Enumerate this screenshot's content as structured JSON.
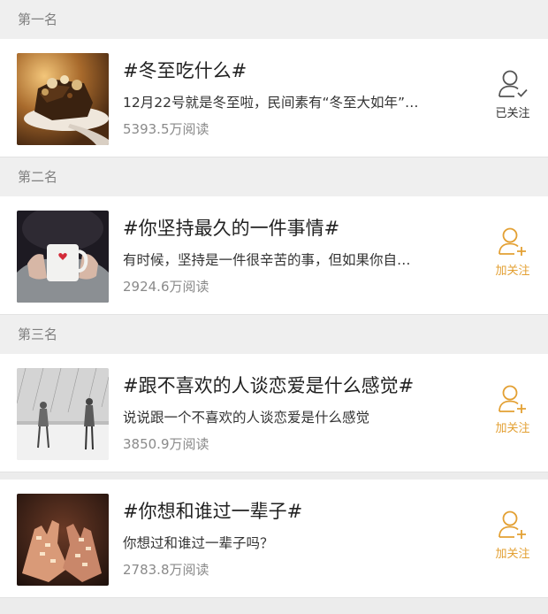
{
  "colors": {
    "accent": "#e3a033",
    "followed_icon": "#555555",
    "muted_text": "#8a8a8a"
  },
  "topics": [
    {
      "rank_label": "第一名",
      "title": "#冬至吃什么#",
      "description": "12月22号就是冬至啦，民间素有“冬至大如年”…",
      "reads": "5393.5万阅读",
      "follow_label": "已关注",
      "followed": true,
      "thumbnail": "dessert-on-spoon-photo"
    },
    {
      "rank_label": "第二名",
      "title": "#你坚持最久的一件事情#",
      "description": "有时候，坚持是一件很辛苦的事，但如果你自…",
      "reads": "2924.6万阅读",
      "follow_label": "加关注",
      "followed": false,
      "thumbnail": "hands-holding-mug-photo"
    },
    {
      "rank_label": "第三名",
      "title": "#跟不喜欢的人谈恋爱是什么感觉#",
      "description": "说说跟一个不喜欢的人谈恋爱是什么感觉",
      "reads": "3850.9万阅读",
      "follow_label": "加关注",
      "followed": false,
      "thumbnail": "couple-sketch-in-rain"
    },
    {
      "title": "#你想和谁过一辈子#",
      "description": "你想过和谁过一辈子吗？",
      "reads": "2783.8万阅读",
      "follow_label": "加关注",
      "followed": false,
      "thumbnail": "hands-in-light-photo"
    }
  ]
}
